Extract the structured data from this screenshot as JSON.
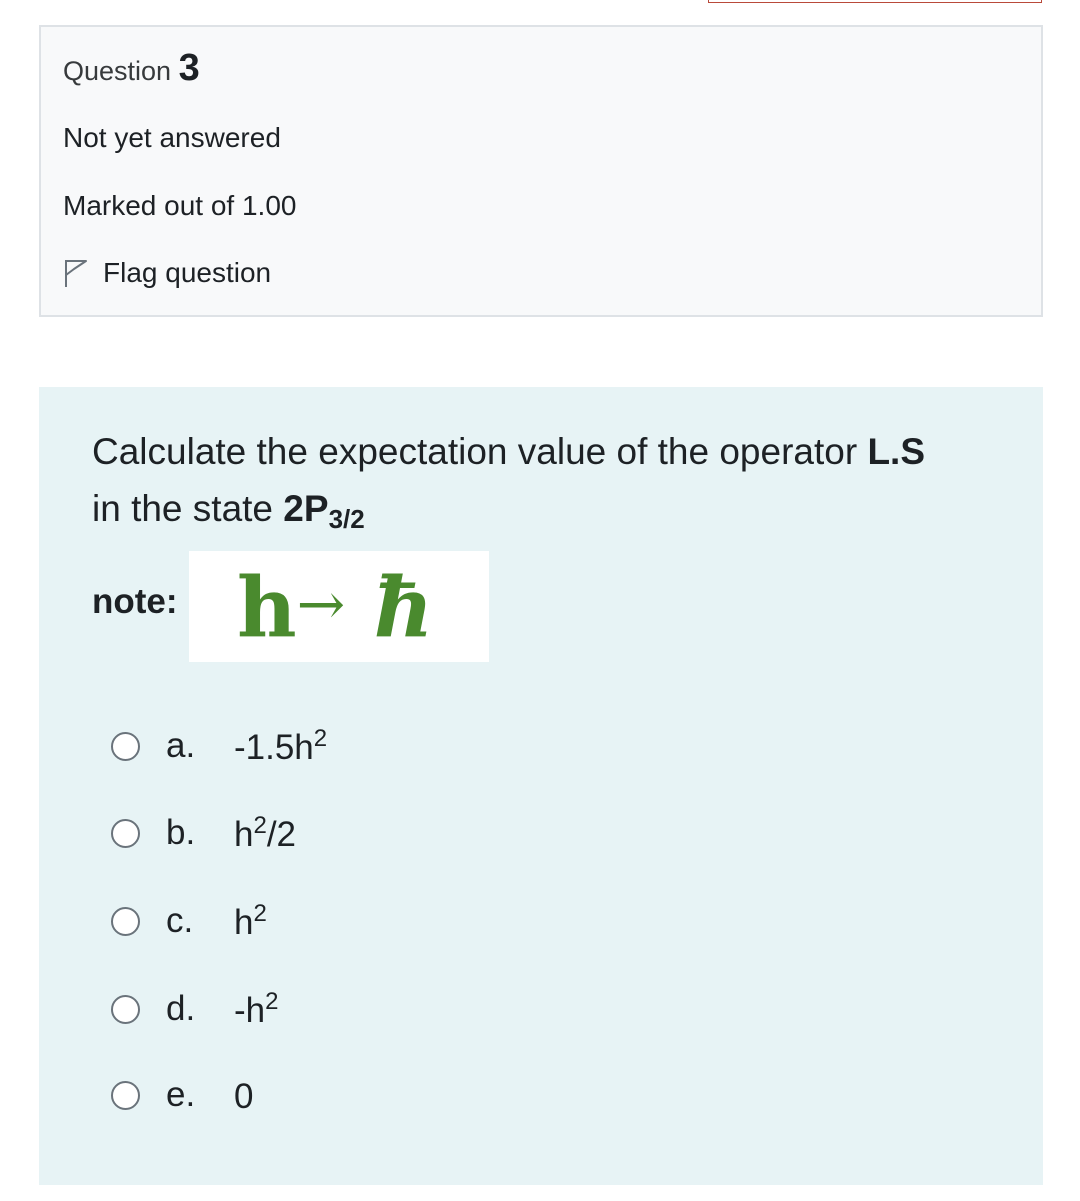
{
  "info": {
    "question_label": "Question",
    "question_number": "3",
    "state": "Not yet answered",
    "marks": "Marked out of 1.00",
    "flag_label": "Flag question"
  },
  "question": {
    "text_part1": "Calculate the expectation value of the operator ",
    "operator": "L.S",
    "text_part2": "in the state ",
    "state_main": "2P",
    "state_sub": "3/2",
    "note_label": "note:",
    "note_formula_left": "h",
    "note_formula_arrow": "→",
    "note_formula_right": "ħ"
  },
  "options": [
    {
      "letter": "a.",
      "base": "-1.5h",
      "sup": "2",
      "rest": ""
    },
    {
      "letter": "b.",
      "base": "h",
      "sup": "2",
      "rest": "/2"
    },
    {
      "letter": "c.",
      "base": "h",
      "sup": "2",
      "rest": ""
    },
    {
      "letter": "d.",
      "base": "-h",
      "sup": "2",
      "rest": ""
    },
    {
      "letter": "e.",
      "base": "0",
      "sup": "",
      "rest": ""
    }
  ]
}
